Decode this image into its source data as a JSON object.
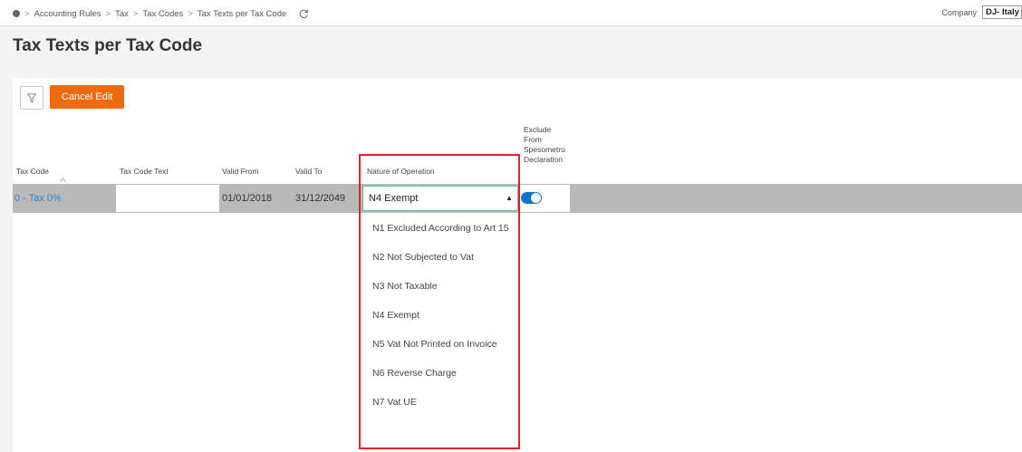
{
  "breadcrumb": {
    "items": [
      "Accounting Rules",
      "Tax",
      "Tax Codes",
      "Tax Texts per Tax Code"
    ],
    "separator": ">"
  },
  "company": {
    "label": "Company",
    "value": "DJ- Italy"
  },
  "page_title": "Tax Texts per Tax Code",
  "toolbar": {
    "cancel_edit_label": "Cancel Edit"
  },
  "columns": {
    "tax_code": "Tax Code",
    "tax_code_text": "Tax Code Text",
    "valid_from": "Valid From",
    "valid_to": "Valid To",
    "nature_of_operation": "Nature of Operation",
    "exclude_line1": "Exclude",
    "exclude_line2": "From",
    "exclude_line3": "Spesometro",
    "exclude_line4": "Declaration"
  },
  "row": {
    "tax_code": "0 - Tax 0%",
    "tax_code_text": "",
    "valid_from": "01/01/2018",
    "valid_to": "31/12/2049",
    "nature_of_operation": "N4 Exempt",
    "exclude_from_spesometro": true
  },
  "dropdown_options": [
    "N1 Excluded According to Art 15",
    "N2 Not Subjected to Vat",
    "N3 Not Taxable",
    "N4 Exempt",
    "N5 Vat Not Printed on Invoice",
    "N6 Reverse Charge",
    "N7 Vat UE"
  ],
  "colors": {
    "accent_orange": "#ef6a0d",
    "link_blue": "#2d86c2",
    "toggle_blue": "#0e74d0",
    "highlight_red": "#e0202a",
    "row_grey": "#b9b9b9"
  }
}
